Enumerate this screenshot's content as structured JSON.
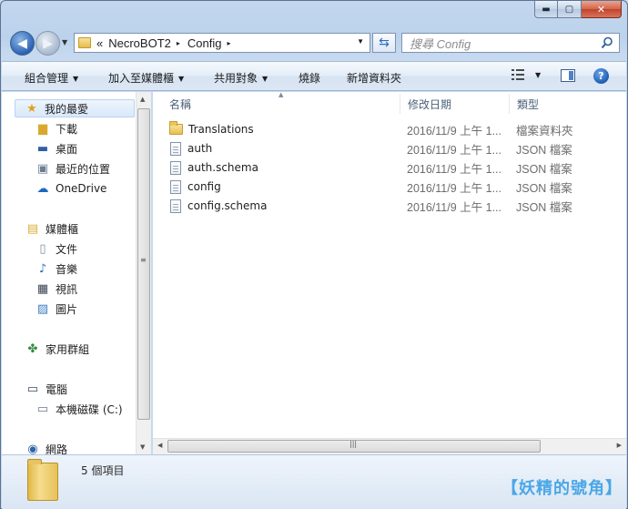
{
  "caption": {
    "minimize": "▬",
    "maximize": "▢",
    "close": "✕"
  },
  "address": {
    "breadcrumb_prefix": "«",
    "segments": [
      "NecroBOT2",
      "Config"
    ],
    "separator": "▸"
  },
  "search": {
    "placeholder": "搜尋 Config"
  },
  "toolbar": {
    "organize": "組合管理",
    "include_in_library": "加入至媒體櫃",
    "share_with": "共用對象",
    "burn": "燒錄",
    "new_folder": "新增資料夾",
    "help": "?"
  },
  "sidebar": {
    "favorites": {
      "label": "我的最愛",
      "items": [
        "下載",
        "桌面",
        "最近的位置",
        "OneDrive"
      ]
    },
    "libraries": {
      "label": "媒體櫃",
      "items": [
        "文件",
        "音樂",
        "視訊",
        "圖片"
      ]
    },
    "homegroup": {
      "label": "家用群組"
    },
    "computer": {
      "label": "電腦",
      "items": [
        "本機磁碟 (C:)"
      ]
    },
    "network": {
      "label": "網路"
    }
  },
  "columns": {
    "name": "名稱",
    "date": "修改日期",
    "type": "類型"
  },
  "files": [
    {
      "name": "Translations",
      "date": "2016/11/9 上午 1...",
      "type": "檔案資料夾",
      "kind": "folder"
    },
    {
      "name": "auth",
      "date": "2016/11/9 上午 1...",
      "type": "JSON 檔案",
      "kind": "file"
    },
    {
      "name": "auth.schema",
      "date": "2016/11/9 上午 1...",
      "type": "JSON 檔案",
      "kind": "file"
    },
    {
      "name": "config",
      "date": "2016/11/9 上午 1...",
      "type": "JSON 檔案",
      "kind": "file"
    },
    {
      "name": "config.schema",
      "date": "2016/11/9 上午 1...",
      "type": "JSON 檔案",
      "kind": "file"
    }
  ],
  "status": {
    "item_count": "5 個項目"
  },
  "watermark": "【妖精的號角】"
}
